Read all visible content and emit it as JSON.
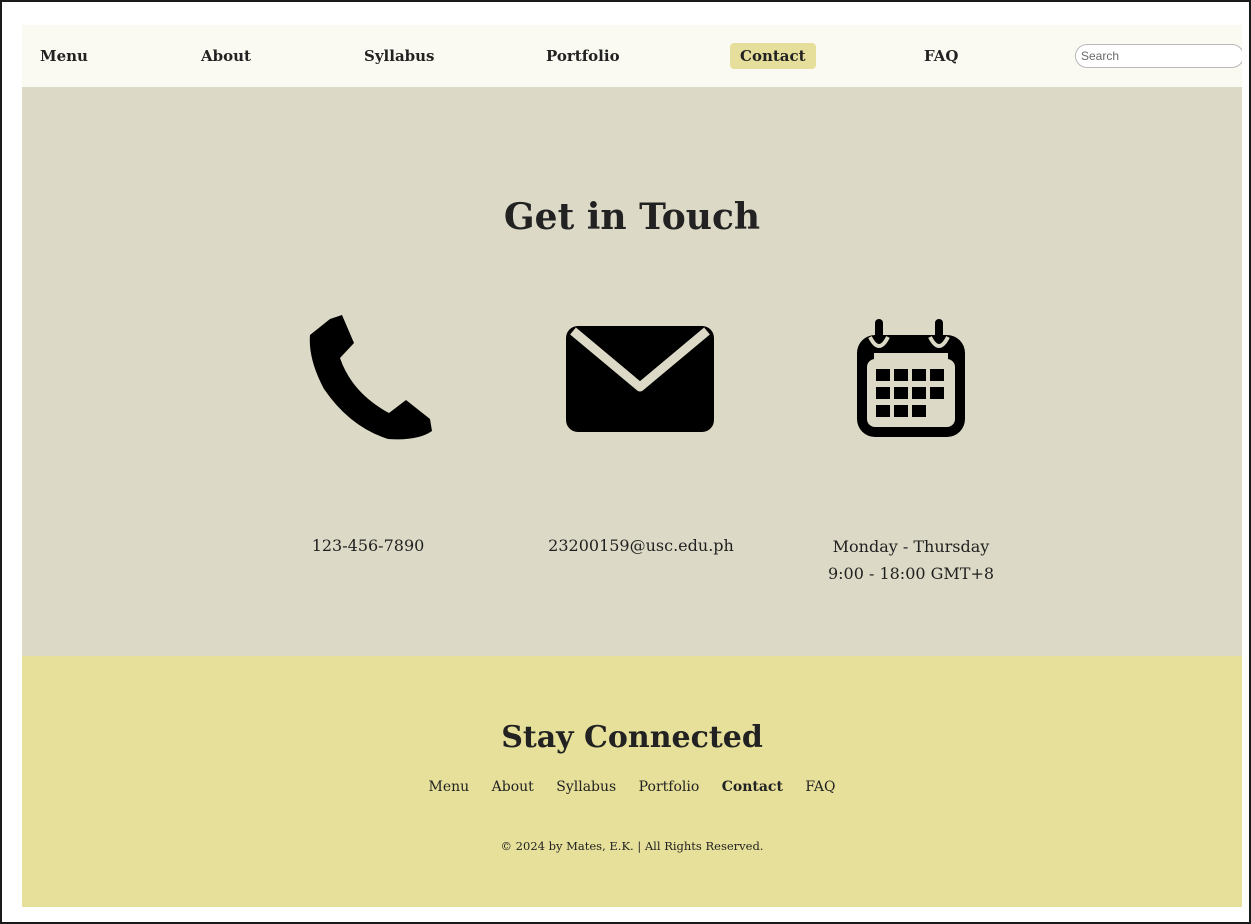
{
  "nav": {
    "items": [
      {
        "label": "Menu",
        "active": false
      },
      {
        "label": "About",
        "active": false
      },
      {
        "label": "Syllabus",
        "active": false
      },
      {
        "label": "Portfolio",
        "active": false
      },
      {
        "label": "Contact",
        "active": true
      },
      {
        "label": "FAQ",
        "active": false
      }
    ],
    "search_placeholder": "Search"
  },
  "contact": {
    "title": "Get in Touch",
    "phone": {
      "icon": "phone-icon",
      "text": "123-456-7890"
    },
    "email": {
      "icon": "envelope-icon",
      "text": "23200159@usc.edu.ph"
    },
    "hours": {
      "icon": "calendar-icon",
      "days": "Monday - Thursday",
      "time": "9:00 - 18:00 GMT+8"
    }
  },
  "footer": {
    "title": "Stay Connected",
    "links": [
      "Menu",
      "About",
      "Syllabus",
      "Portfolio",
      "Contact",
      "FAQ"
    ],
    "active_link": "Contact",
    "copyright": "© 2024 by Mates, E.K. | All Rights Reserved."
  },
  "colors": {
    "nav_bg": "#fafaf2",
    "active_bg": "#e6df9b",
    "section_bg": "#dcdac6",
    "footer_bg": "#e6e09a"
  }
}
